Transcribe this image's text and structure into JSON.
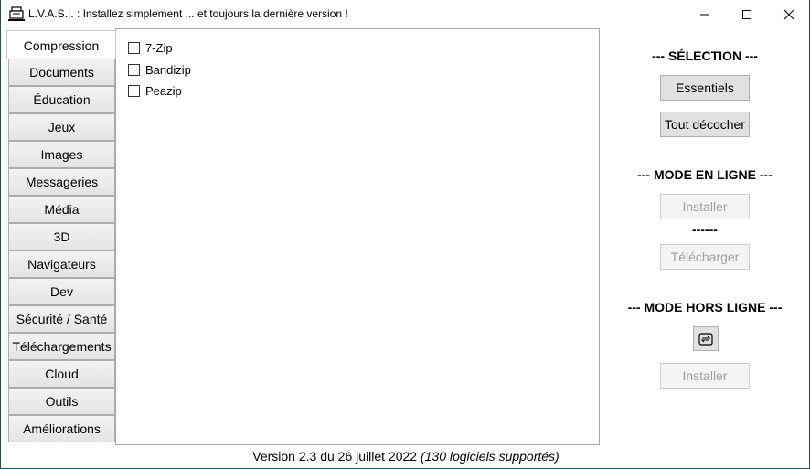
{
  "window": {
    "title": "L.V.A.S.I. : Installez simplement ... et toujours la dernière version !",
    "icon": "printer-computer-icon",
    "controls": {
      "minimize": "minimize-icon",
      "maximize": "maximize-icon",
      "close": "close-icon"
    }
  },
  "tabs": {
    "active": "Compression",
    "items": [
      "Compression",
      "Documents",
      "Éducation",
      "Jeux",
      "Images",
      "Messageries",
      "Média",
      "3D",
      "Navigateurs",
      "Dev",
      "Sécurité / Santé",
      "Téléchargements",
      "Cloud",
      "Outils",
      "Améliorations"
    ]
  },
  "panel": {
    "checkboxes": [
      {
        "label": "7-Zip",
        "checked": false
      },
      {
        "label": "Bandizip",
        "checked": false
      },
      {
        "label": "Peazip",
        "checked": false
      }
    ]
  },
  "right": {
    "selection_title": "--- SÉLECTION ---",
    "essentials_label": "Essentiels",
    "uncheck_all_label": "Tout décocher",
    "online_title": "--- MODE EN LIGNE ---",
    "online_install_label": "Installer",
    "separator": "------",
    "download_label": "Télécharger",
    "offline_title": "--- MODE HORS LIGNE ---",
    "offline_icon": "swap-icon",
    "offline_install_label": "Installer"
  },
  "footer": {
    "version": "Version 2.3 du 26 juillet 2022 ",
    "count": "(130 logiciels supportés)"
  }
}
